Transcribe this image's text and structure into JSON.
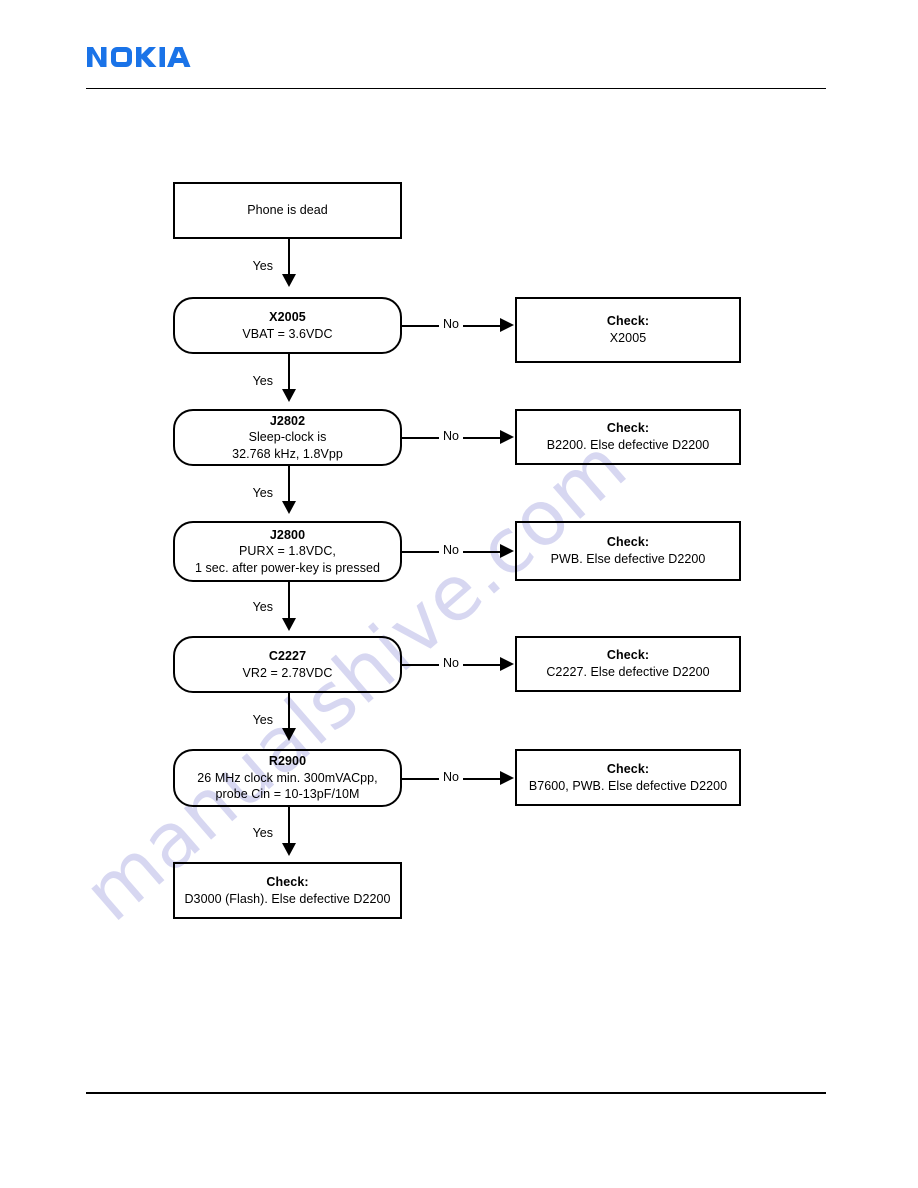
{
  "page": {
    "brand": "NOKIA",
    "brand_color": "#1a73e8",
    "watermark": "manualshive.com"
  },
  "flowchart": {
    "type": "troubleshooting-flowchart",
    "yes_label": "Yes",
    "no_label": "No",
    "check_label": "Check:",
    "start": {
      "text": "Phone is dead"
    },
    "steps": [
      {
        "title": "X2005",
        "lines": [
          "VBAT = 3.6VDC"
        ],
        "check": {
          "title": "Check:",
          "lines": [
            "X2005"
          ]
        }
      },
      {
        "title": "J2802",
        "lines": [
          "Sleep-clock is",
          "32.768 kHz, 1.8Vpp"
        ],
        "check": {
          "title": "Check:",
          "lines": [
            "B2200. Else defective D2200"
          ]
        }
      },
      {
        "title": "J2800",
        "lines": [
          "PURX = 1.8VDC,",
          "1 sec. after power-key is pressed"
        ],
        "check": {
          "title": "Check:",
          "lines": [
            "PWB. Else defective D2200"
          ]
        }
      },
      {
        "title": "C2227",
        "lines": [
          "VR2 = 2.78VDC"
        ],
        "check": {
          "title": "Check:",
          "lines": [
            "C2227. Else defective D2200"
          ]
        }
      },
      {
        "title": "R2900",
        "lines": [
          "26 MHz clock min. 300mVACpp,",
          "probe Cin = 10-13pF/10M"
        ],
        "check": {
          "title": "Check:",
          "lines": [
            "B7600, PWB. Else defective D2200"
          ]
        }
      }
    ],
    "end": {
      "title": "Check:",
      "lines": [
        "D3000 (Flash). Else defective D2200"
      ]
    }
  }
}
